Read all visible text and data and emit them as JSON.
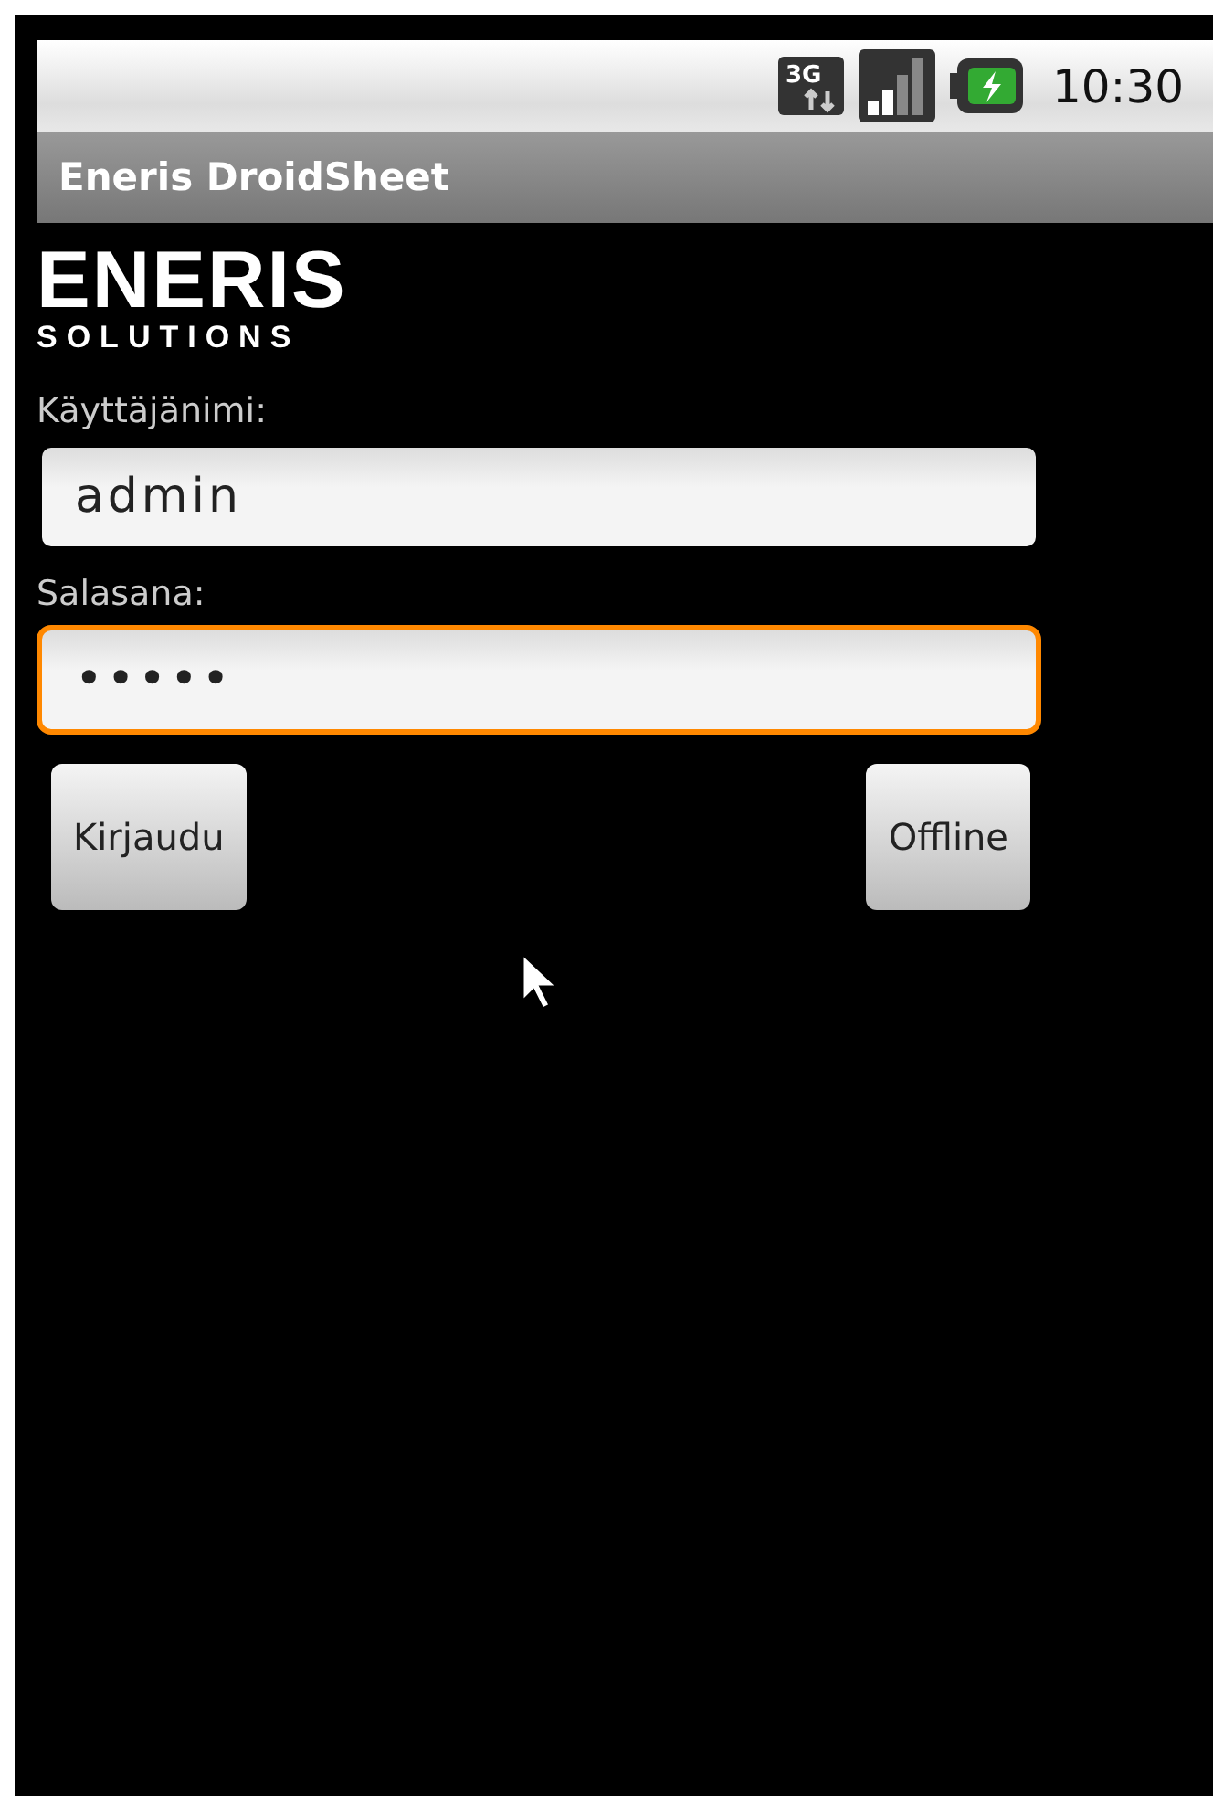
{
  "status_bar": {
    "network_type": "3G",
    "time": "10:30"
  },
  "title_bar": {
    "title": "Eneris DroidSheet"
  },
  "logo": {
    "name": "ENERIS",
    "tagline": "SOLUTIONS"
  },
  "fields": [
    {
      "label": "Käyttäjänimi:",
      "value": "admin",
      "focused": false
    },
    {
      "label": "Salasana:",
      "value": "•••••",
      "focused": true
    }
  ],
  "buttons": [
    "Kirjaudu",
    "Offline"
  ]
}
